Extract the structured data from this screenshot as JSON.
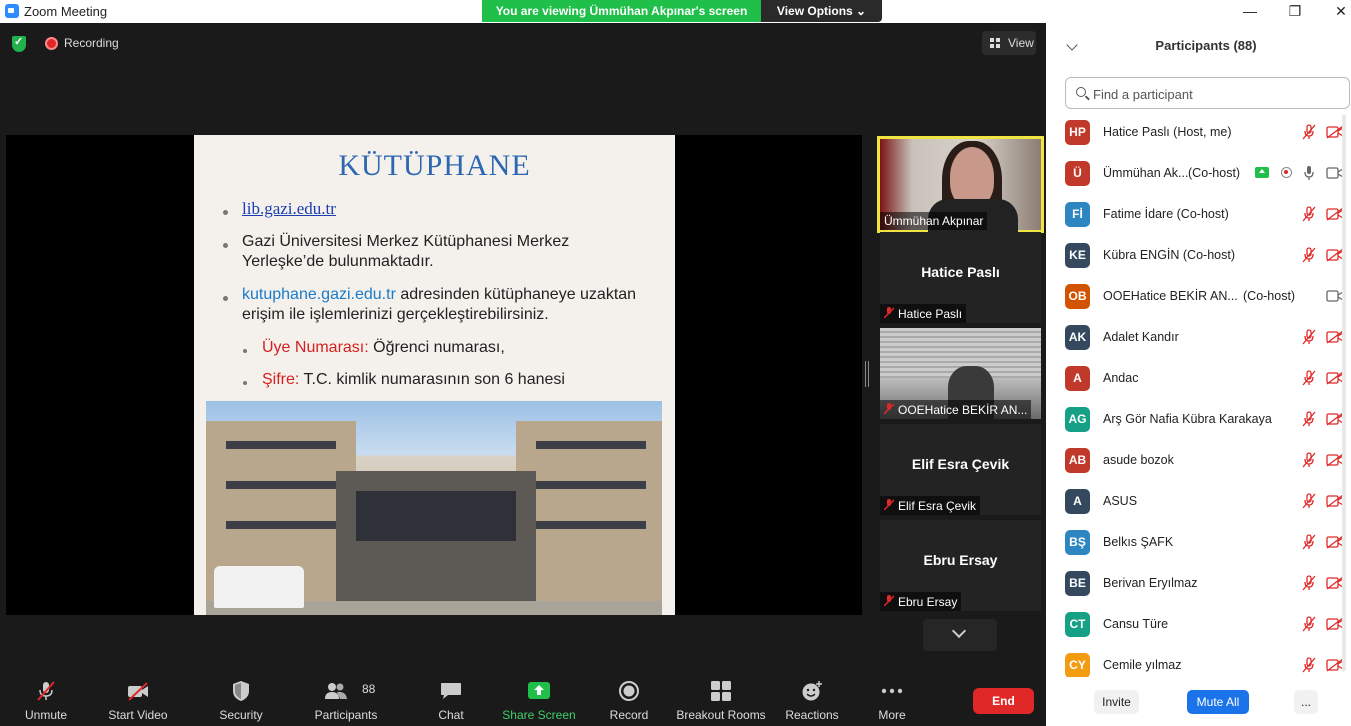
{
  "window": {
    "title": "Zoom Meeting",
    "minimize": "—",
    "restore": "❐",
    "close": "✕"
  },
  "banner": {
    "message": "You are viewing Ümmühan Akpınar's screen",
    "view_options": "View Options ⌄"
  },
  "meeting": {
    "recording_label": "Recording",
    "view_label": "View"
  },
  "slide": {
    "title": "KÜTÜPHANE",
    "link1": "lib.gazi.edu.tr",
    "bullet2_line1": "Gazi Üniversitesi Merkez Kütüphanesi Merkez",
    "bullet2_line2": "Yerleşke’de bulunmaktadır.",
    "bullet3_link": "kutuphane.gazi.edu.tr",
    "bullet3_rest": " adresinden kütüphaneye uzaktan",
    "bullet3_line2": "erişim ile işlemlerinizi gerçekleştirebilirsiniz.",
    "sub1_label": "Üye Numarası:",
    "sub1_value": " Öğrenci numarası,",
    "sub2_label": "Şifre:",
    "sub2_value": " T.C. kimlik numarasının son 6 hanesi"
  },
  "thumbnails": [
    {
      "name": "Ümmühan Akpınar",
      "big": ""
    },
    {
      "name": "Hatice Paslı",
      "big": "Hatice Paslı"
    },
    {
      "name": "OOEHatice BEKİR AN...",
      "big": ""
    },
    {
      "name": "Elif Esra Çevik",
      "big": "Elif Esra Çevik"
    },
    {
      "name": "Ebru Ersay",
      "big": "Ebru Ersay"
    }
  ],
  "toolbar": {
    "unmute": "Unmute",
    "start_video": "Start Video",
    "security": "Security",
    "participants": "Participants",
    "participants_count": "88",
    "chat": "Chat",
    "share_screen": "Share Screen",
    "record": "Record",
    "breakout": "Breakout Rooms",
    "reactions": "Reactions",
    "more": "More",
    "end": "End"
  },
  "panel": {
    "title": "Participants (88)",
    "search_placeholder": "Find a participant",
    "participants": [
      {
        "initials": "HP",
        "name": "Hatice Paslı (Host, me)",
        "color": "#c0392b"
      },
      {
        "initials": "Ü",
        "name": "Ümmühan Ak...",
        "note": "(Co-host)",
        "color": "#c0392b"
      },
      {
        "initials": "Fİ",
        "name": "Fatime İdare (Co-host)",
        "color": "#2e86c1"
      },
      {
        "initials": "KE",
        "name": "Kübra ENGİN (Co-host)",
        "color": "#34495e"
      },
      {
        "initials": "OB",
        "name": "OOEHatice BEKİR AN...",
        "note": "(Co-host)",
        "color": "#d35400"
      },
      {
        "initials": "AK",
        "name": "Adalet Kandır",
        "color": "#34495e"
      },
      {
        "initials": "A",
        "name": "Andac",
        "color": "#c0392b"
      },
      {
        "initials": "AG",
        "name": "Arş Gör Nafia Kübra Karakaya",
        "color": "#16a085"
      },
      {
        "initials": "AB",
        "name": "asude bozok",
        "color": "#c0392b"
      },
      {
        "initials": "A",
        "name": "ASUS",
        "color": "#34495e"
      },
      {
        "initials": "BŞ",
        "name": "Belkıs ŞAFK",
        "color": "#2e86c1"
      },
      {
        "initials": "BE",
        "name": "Berivan Eryılmaz",
        "color": "#34495e"
      },
      {
        "initials": "CT",
        "name": "Cansu Türe",
        "color": "#16a085"
      },
      {
        "initials": "CY",
        "name": "Cemile yılmaz",
        "color": "#f39c12"
      }
    ],
    "invite": "Invite",
    "mute_all": "Mute All",
    "more": "..."
  }
}
